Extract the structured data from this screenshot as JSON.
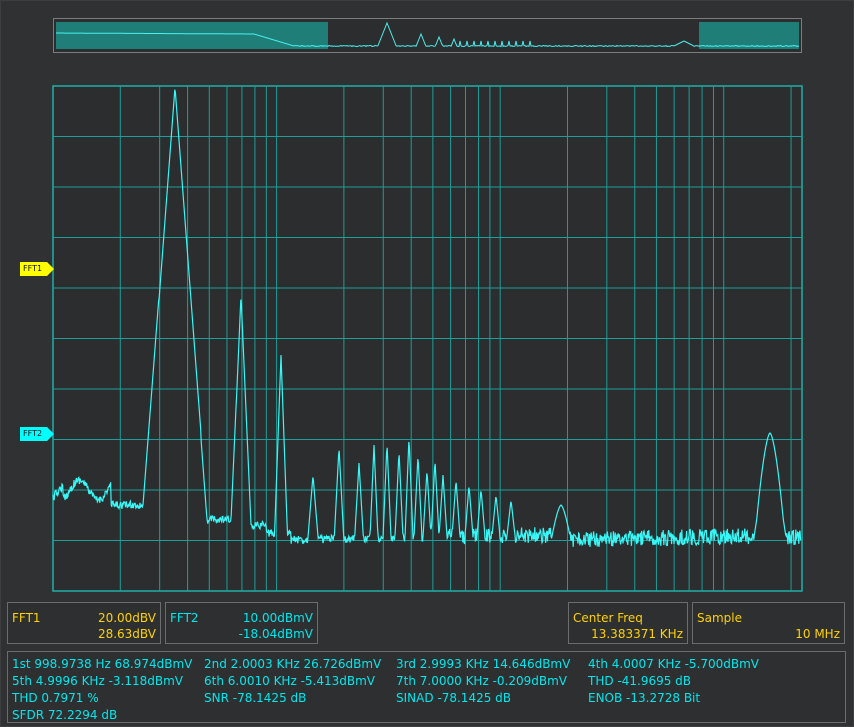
{
  "chart_data": {
    "type": "line",
    "title": "",
    "xscale": "log",
    "grid": true,
    "series": [
      {
        "name": "FFT2",
        "color": "#00ffff",
        "peaks": [
          {
            "label": "1st",
            "freq": "998.9738 Hz",
            "level": "68.974dBmV"
          },
          {
            "label": "2nd",
            "freq": "2.0003 KHz",
            "level": "26.726dBmV"
          },
          {
            "label": "3rd",
            "freq": "2.9993 KHz",
            "level": "14.646dBmV"
          },
          {
            "label": "4th",
            "freq": "4.0007 KHz",
            "level": "-5.700dBmV"
          },
          {
            "label": "5th",
            "freq": "4.9996 KHz",
            "level": "-3.118dBmV"
          },
          {
            "label": "6th",
            "freq": "6.0010 KHz",
            "level": "-5.413dBmV"
          },
          {
            "label": "7th",
            "freq": "7.0000 KHz",
            "level": "-0.209dBmV"
          }
        ]
      }
    ]
  },
  "markers": {
    "fft1": "FFT1",
    "fft2": "FFT2"
  },
  "scale_boxes": {
    "fft1": {
      "name": "FFT1",
      "scale": "20.00dBV",
      "offset": "28.63dBV",
      "color": "#ffd200"
    },
    "fft2": {
      "name": "FFT2",
      "scale": "10.00dBmV",
      "offset": "-18.04dBmV",
      "color": "#00e8ee"
    },
    "center": {
      "name": "Center Freq",
      "value": "13.383371 KHz"
    },
    "sample": {
      "name": "Sample",
      "value": "10 MHz"
    }
  },
  "measurements": {
    "h1": "1st 998.9738 Hz  68.974dBmV",
    "h2": "2nd 2.0003 KHz  26.726dBmV",
    "h3": "3rd 2.9993 KHz  14.646dBmV",
    "h4": "4th 4.0007 KHz  -5.700dBmV",
    "h5": "5th 4.9996 KHz  -3.118dBmV",
    "h6": "6th 6.0010 KHz  -5.413dBmV",
    "h7": "7th 7.0000 KHz  -0.209dBmV",
    "thd_db": "THD  -41.9695 dB",
    "thd_pct": "THD  0.7971 %",
    "snr": "SNR  -78.1425 dB",
    "sinad": "SINAD  -78.1425 dB",
    "enob": "ENOB  -13.2728 Bit",
    "sfdr": "SFDR  72.2294 dB"
  }
}
